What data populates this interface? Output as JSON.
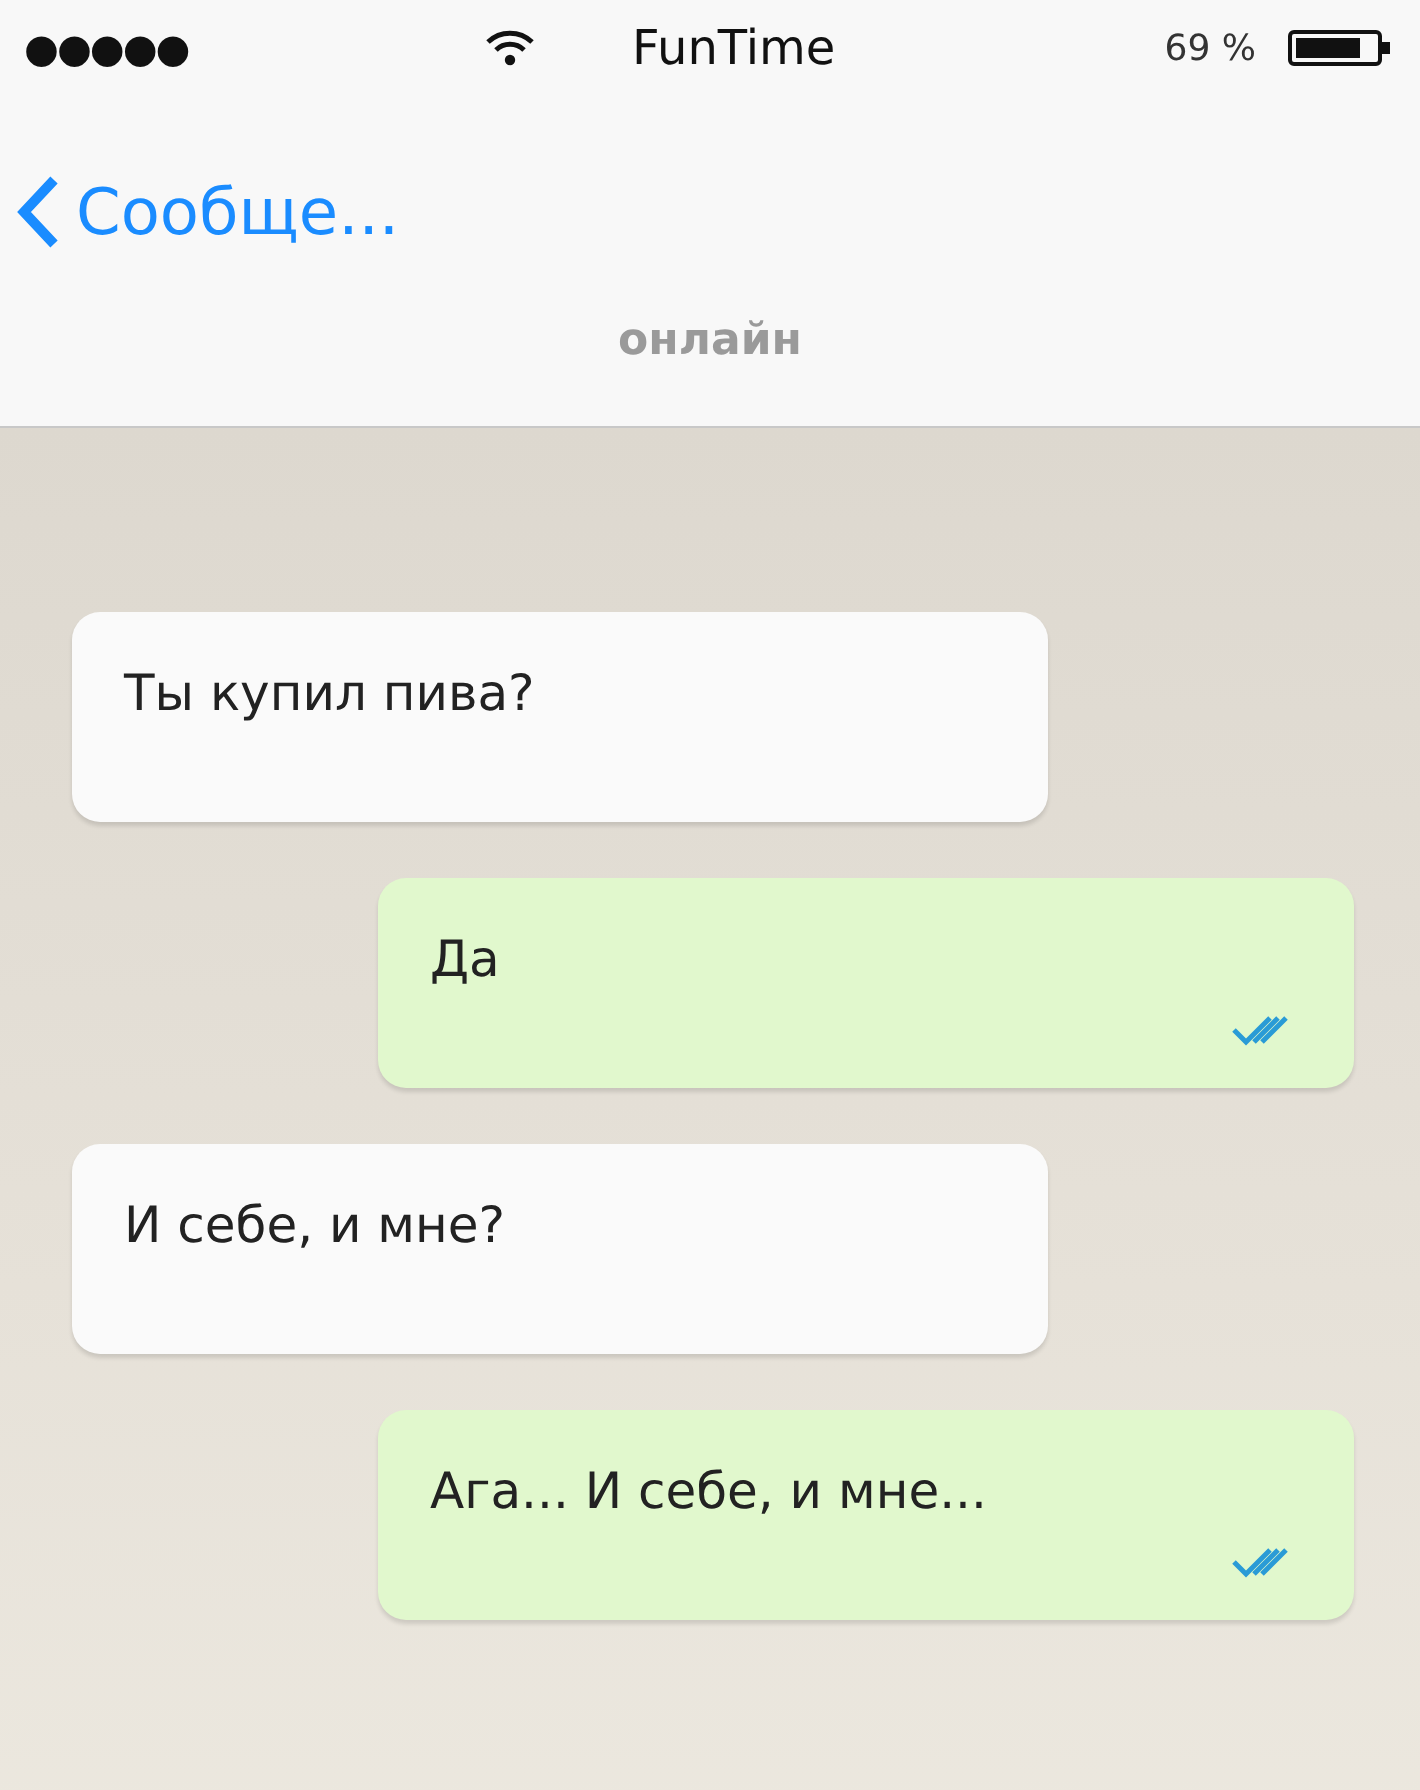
{
  "status_bar": {
    "carrier_dots": "●●●●●",
    "app_name": "FunTime",
    "battery_text": "69 %"
  },
  "nav_bar": {
    "back_label": "Сообще...",
    "subtitle": "онлайн"
  },
  "messages": [
    {
      "kind": "incoming",
      "text": "Ты купил пива?"
    },
    {
      "kind": "outgoing",
      "text": "Да",
      "read": true
    },
    {
      "kind": "incoming",
      "text": "И себе, и мне?"
    },
    {
      "kind": "outgoing",
      "text": "Ага... И себе, и мне...",
      "read": true
    }
  ]
}
